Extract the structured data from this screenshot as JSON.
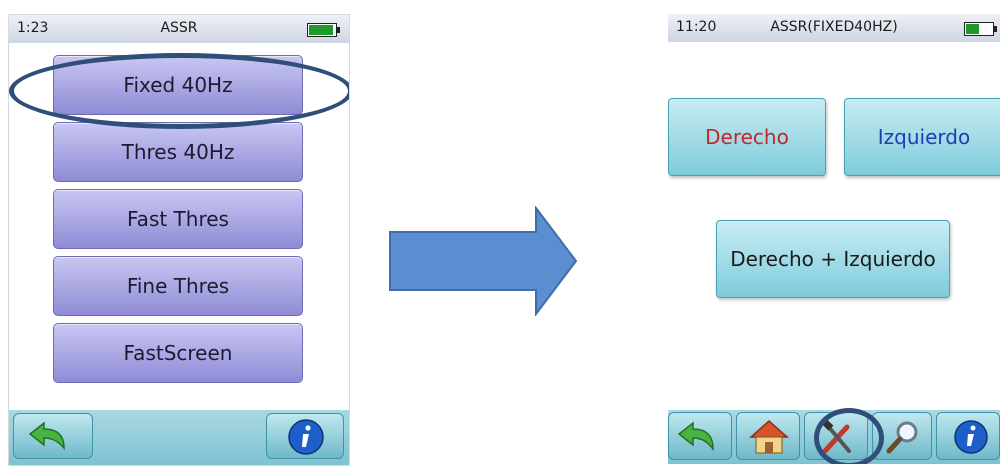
{
  "left_screen": {
    "time": "1:23",
    "title": "ASSR",
    "menu_items": [
      "Fixed 40Hz",
      "Thres 40Hz",
      "Fast Thres",
      "Fine Thres",
      "FastScreen"
    ]
  },
  "right_screen": {
    "time": "11:20",
    "title": "ASSR(FIXED40HZ)",
    "buttons": {
      "right_ear": "Derecho",
      "left_ear": "Izquierdo",
      "both_ears": "Derecho + Izquierdo"
    }
  },
  "colors": {
    "right_ear_text": "#c0282a",
    "left_ear_text": "#1d3fb0",
    "highlight_oval": "#2f4e79",
    "arrow_fill": "#5b8ed0"
  },
  "icons": [
    "back-icon",
    "info-icon",
    "home-icon",
    "tools-icon",
    "search-icon",
    "battery-icon",
    "arrow-right-icon"
  ]
}
